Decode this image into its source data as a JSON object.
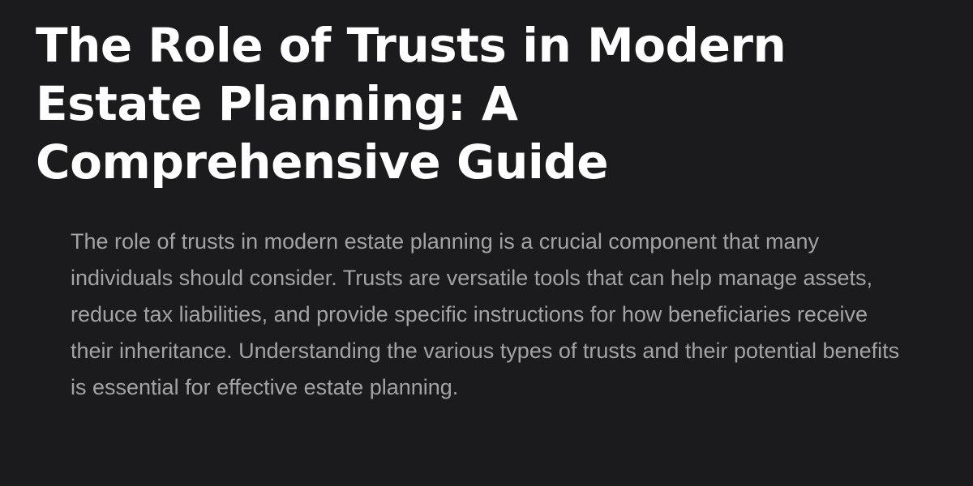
{
  "article": {
    "title": "The Role of Trusts in Modern Estate Planning: A Comprehensive Guide",
    "intro": "The role of trusts in modern estate planning is a crucial component that many individuals should consider. Trusts are versatile tools that can help manage assets, reduce tax liabilities, and provide specific instructions for how beneficiaries receive their inheritance. Understanding the various types of trusts and their potential benefits is essential for effective estate planning."
  },
  "colors": {
    "background": "#1b1b1d",
    "title": "#ffffff",
    "body_text": "#a3a3a6"
  }
}
